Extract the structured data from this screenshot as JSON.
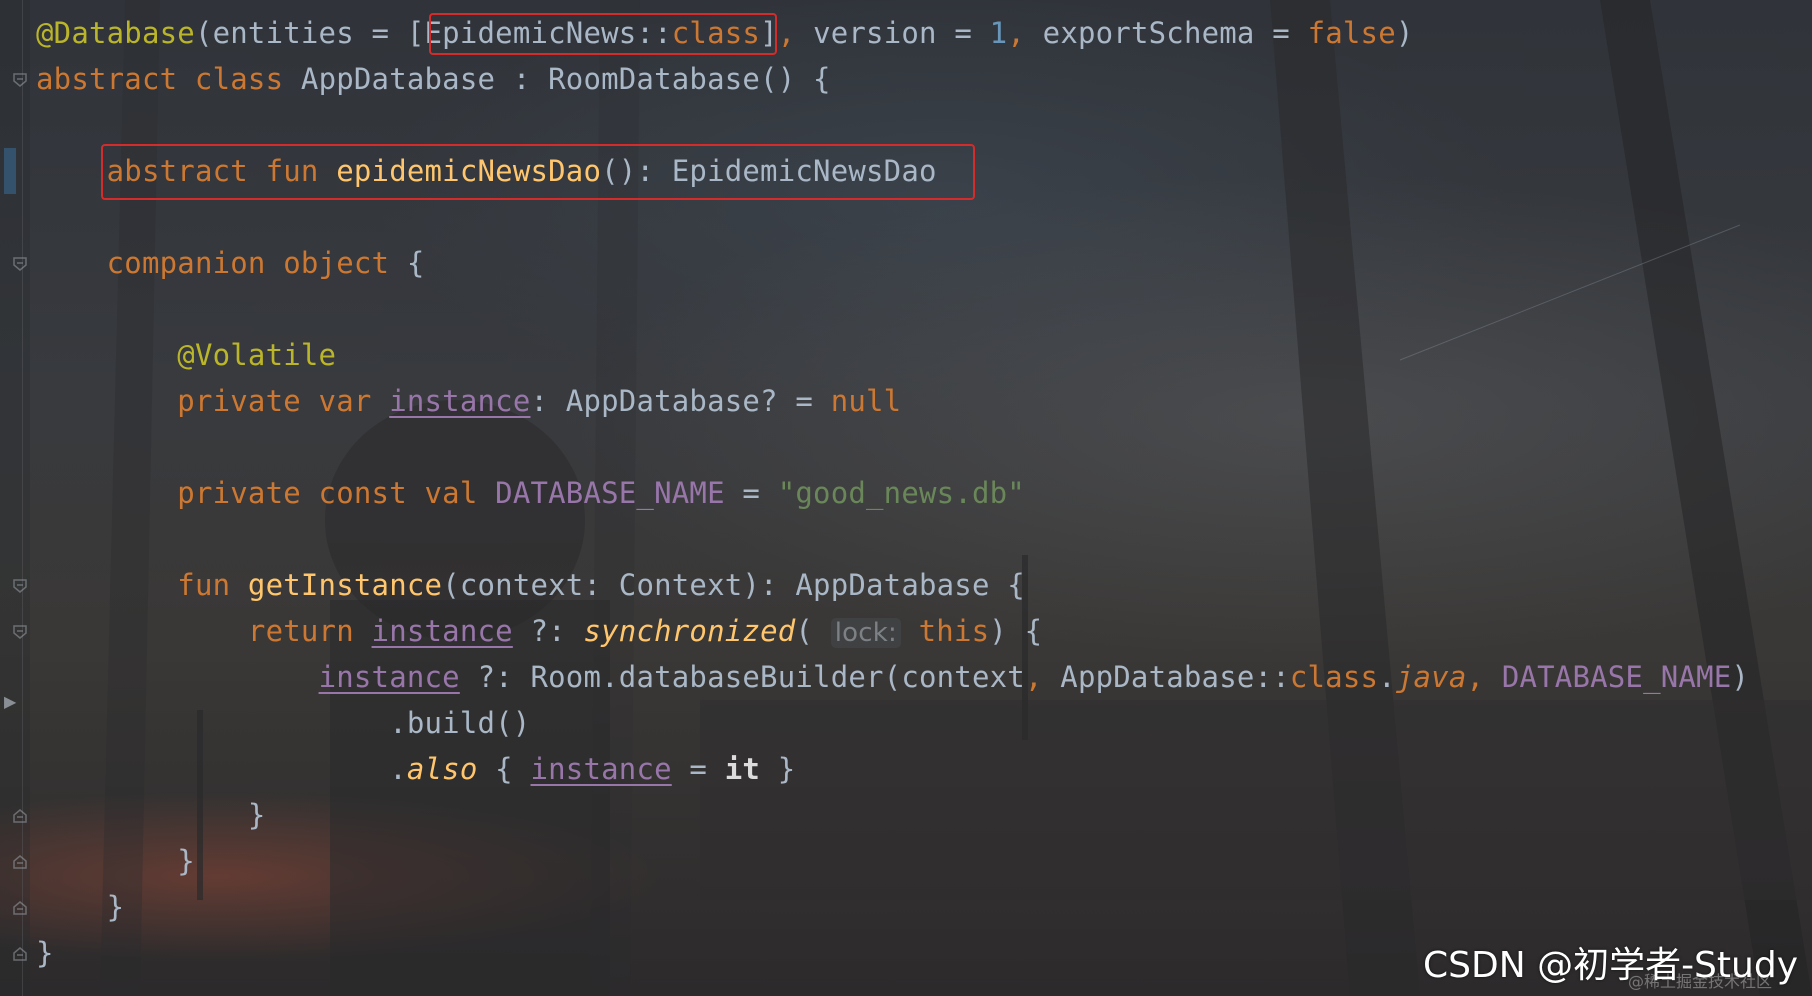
{
  "code_lines": [
    [
      {
        "t": "@Database",
        "c": "ann"
      },
      {
        "t": "(entities = ["
      },
      {
        "t": "EpidemicNews::",
        "c": ""
      },
      {
        "t": "class",
        "c": "kw"
      },
      {
        "t": "]"
      },
      {
        "t": ", ",
        "c": "kw"
      },
      {
        "t": "version = "
      },
      {
        "t": "1",
        "c": "num"
      },
      {
        "t": ", ",
        "c": "kw"
      },
      {
        "t": "exportSchema = "
      },
      {
        "t": "false",
        "c": "kw"
      },
      {
        "t": ")"
      }
    ],
    [
      {
        "t": "abstract class ",
        "c": "kw"
      },
      {
        "t": "AppDatabase : RoomDatabase() {"
      }
    ],
    [],
    [
      {
        "t": "    "
      },
      {
        "t": "abstract fun ",
        "c": "kw"
      },
      {
        "t": "epidemicNewsDao",
        "c": "fn"
      },
      {
        "t": "(): EpidemicNewsDao"
      }
    ],
    [],
    [
      {
        "t": "    "
      },
      {
        "t": "companion object ",
        "c": "kw"
      },
      {
        "t": "{"
      }
    ],
    [],
    [
      {
        "t": "        "
      },
      {
        "t": "@Volatile",
        "c": "ann"
      }
    ],
    [
      {
        "t": "        "
      },
      {
        "t": "private var ",
        "c": "kw"
      },
      {
        "t": "instance",
        "c": "prop"
      },
      {
        "t": ": AppDatabase? = "
      },
      {
        "t": "null",
        "c": "kw"
      }
    ],
    [],
    [
      {
        "t": "        "
      },
      {
        "t": "private const val ",
        "c": "kw"
      },
      {
        "t": "DATABASE_NAME",
        "c": "const"
      },
      {
        "t": " = "
      },
      {
        "t": "\"good_news.db\"",
        "c": "str"
      }
    ],
    [],
    [
      {
        "t": "        "
      },
      {
        "t": "fun ",
        "c": "kw"
      },
      {
        "t": "getInstance",
        "c": "fn"
      },
      {
        "t": "(context: Context): AppDatabase {"
      }
    ],
    [
      {
        "t": "            "
      },
      {
        "t": "return ",
        "c": "kw"
      },
      {
        "t": "instance",
        "c": "prop"
      },
      {
        "t": " ?: "
      },
      {
        "t": "synchronized",
        "c": "ital"
      },
      {
        "t": "( "
      },
      {
        "t": "lock:",
        "c": "hint"
      },
      {
        "t": " "
      },
      {
        "t": "this",
        "c": "kw"
      },
      {
        "t": ") {"
      }
    ],
    [
      {
        "t": "                "
      },
      {
        "t": "instance",
        "c": "prop"
      },
      {
        "t": " ?: Room.databaseBuilder(context"
      },
      {
        "t": ", ",
        "c": "kw"
      },
      {
        "t": "AppDatabase::"
      },
      {
        "t": "class",
        "c": "kw"
      },
      {
        "t": "."
      },
      {
        "t": "java",
        "c": "italkw"
      },
      {
        "t": ", ",
        "c": "kw"
      },
      {
        "t": "DATABASE_NAME",
        "c": "const"
      },
      {
        "t": ")"
      }
    ],
    [
      {
        "t": "                    .build()"
      }
    ],
    [
      {
        "t": "                    ."
      },
      {
        "t": "also",
        "c": "ital"
      },
      {
        "t": " { "
      },
      {
        "t": "instance",
        "c": "prop"
      },
      {
        "t": " = "
      },
      {
        "t": "it",
        "c": "whitebold"
      },
      {
        "t": " }"
      }
    ],
    [
      {
        "t": "            }"
      }
    ],
    [
      {
        "t": "        }"
      }
    ],
    [
      {
        "t": "    }"
      }
    ],
    [
      {
        "t": "}"
      }
    ]
  ],
  "watermark": "CSDN @初学者-Study",
  "watermark_small": "@稀土掘金技术社区",
  "colors": {
    "annotation": "#bbb529",
    "keyword": "#cc7832",
    "function": "#ffc66d",
    "number": "#6897bb",
    "string": "#6a8759",
    "constant": "#9876aa",
    "text": "#a9b7c6",
    "highlight_box": "#d42b2b"
  }
}
